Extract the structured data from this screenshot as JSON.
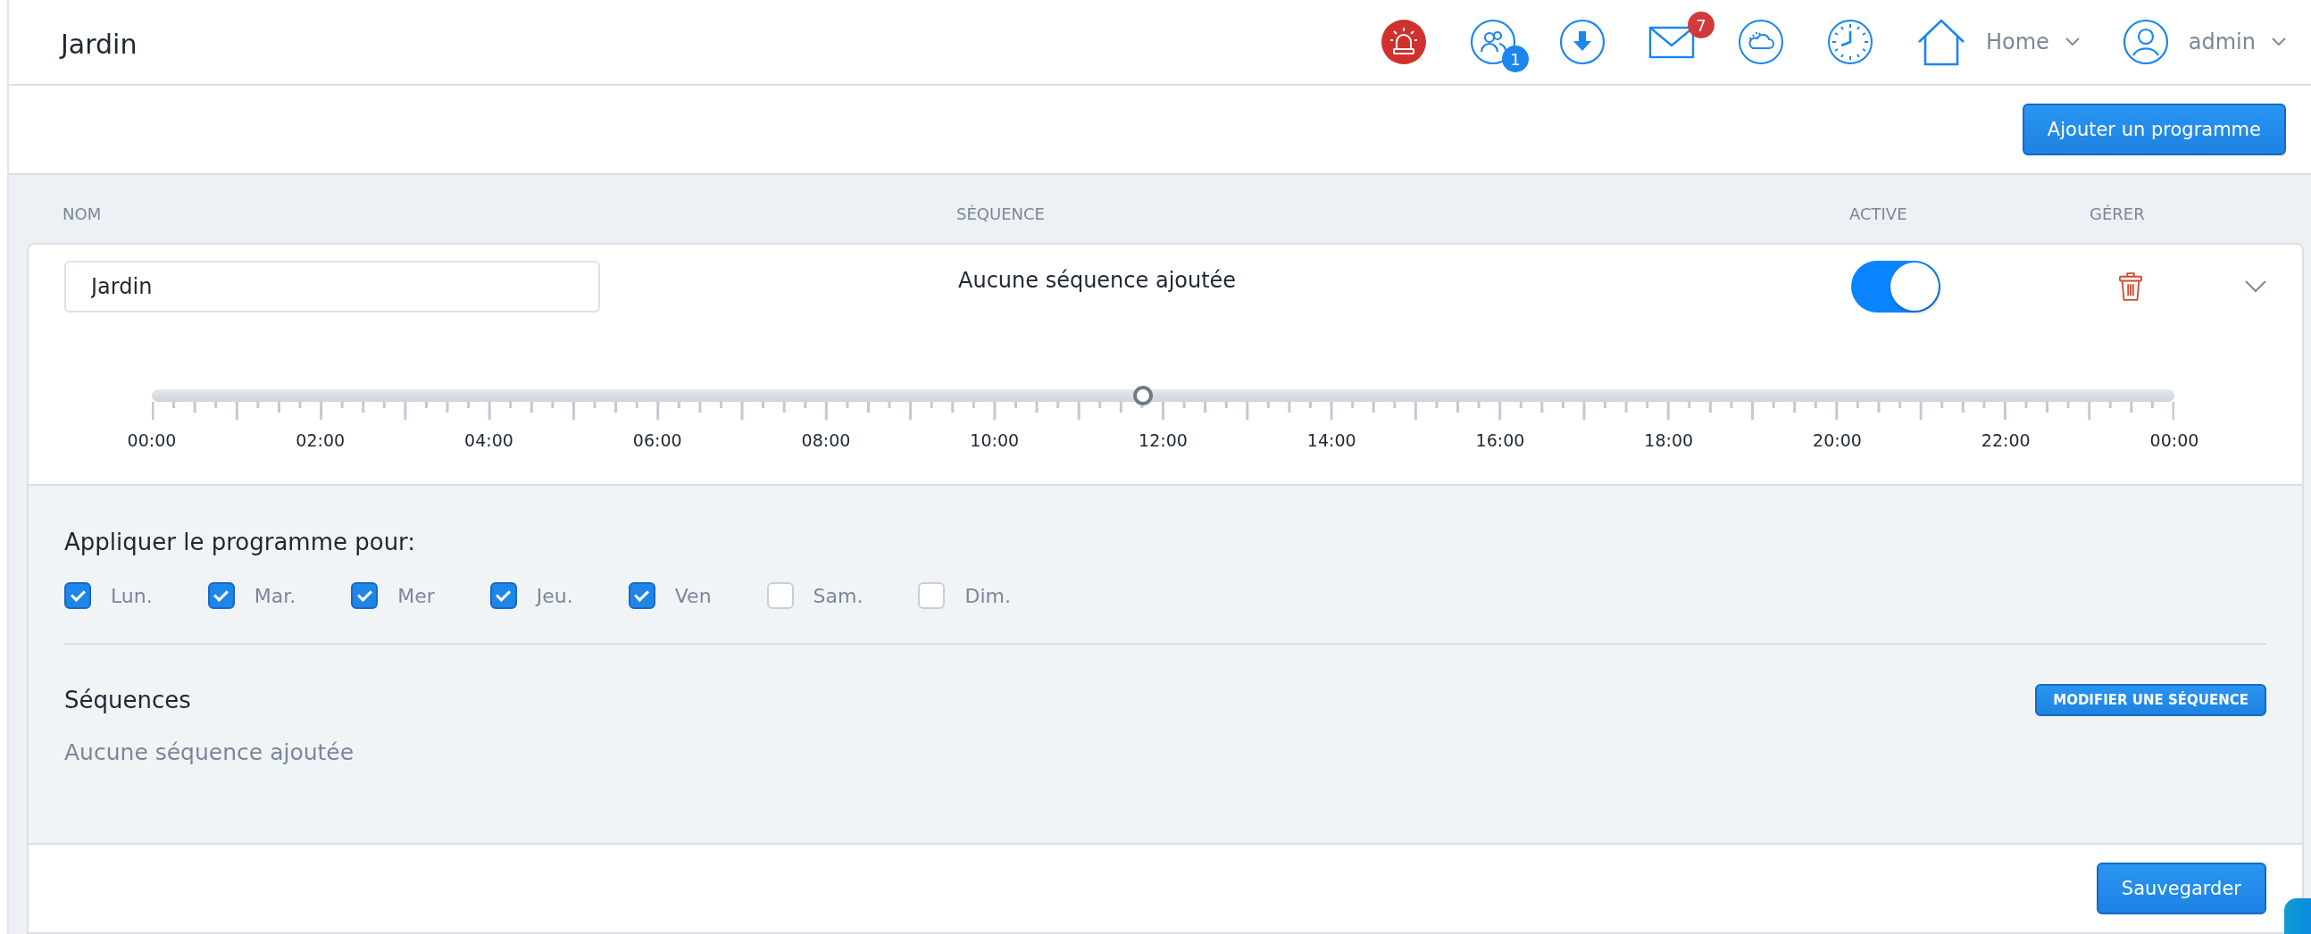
{
  "header": {
    "title": "Jardin",
    "users_badge": "1",
    "mail_badge": "7",
    "home_menu": "Home",
    "user_menu": "admin"
  },
  "add_button": "Ajouter un programme",
  "columns": [
    "NOM",
    "SÉQUENCE",
    "ACTIVE",
    "GÉRER"
  ],
  "program": {
    "name": "Jardin",
    "sequence_summary": "Aucune séquence ajoutée",
    "active": true,
    "slider": {
      "level": 0.49,
      "labels": [
        "00:00",
        "02:00",
        "04:00",
        "06:00",
        "08:00",
        "10:00",
        "12:00",
        "14:00",
        "16:00",
        "18:00",
        "20:00",
        "22:00",
        "00:00"
      ]
    }
  },
  "schedule": {
    "heading": "Appliquer le programme pour:",
    "days": [
      {
        "label": "Lun.",
        "checked": true
      },
      {
        "label": "Mar.",
        "checked": true
      },
      {
        "label": "Mer",
        "checked": true
      },
      {
        "label": "Jeu.",
        "checked": true
      },
      {
        "label": "Ven",
        "checked": true
      },
      {
        "label": "Sam.",
        "checked": false
      },
      {
        "label": "Dim.",
        "checked": false
      }
    ]
  },
  "sequences": {
    "heading": "Séquences",
    "edit_button": "MODIFIER UNE SÉQUENCE",
    "empty_text": "Aucune séquence ajoutée"
  },
  "save_button": "Sauvegarder"
}
